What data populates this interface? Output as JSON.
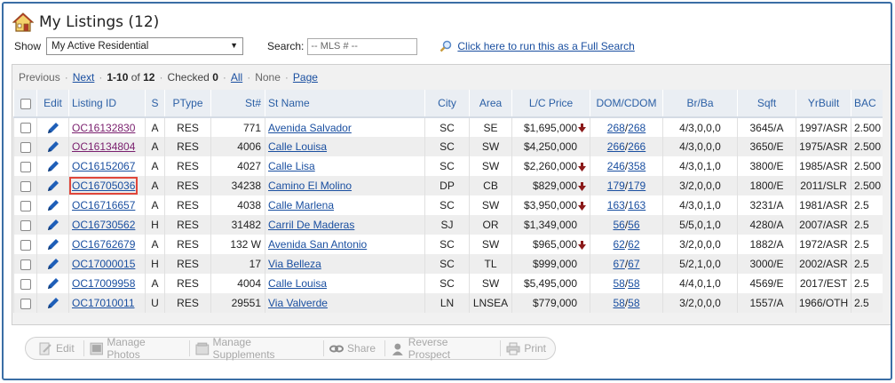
{
  "header": {
    "title": "My Listings (12)"
  },
  "controls": {
    "show_label": "Show",
    "show_value": "My Active Residential",
    "search_label": "Search:",
    "search_placeholder": "-- MLS # --",
    "full_search_link": "Click here to run this as a Full Search"
  },
  "pager": {
    "previous": "Previous",
    "next": "Next",
    "range": "1-10",
    "of_label": "of",
    "total": "12",
    "checked_label": "Checked",
    "checked_count": "0",
    "all": "All",
    "none": "None",
    "page": "Page"
  },
  "columns": [
    "Edit",
    "Listing ID",
    "S",
    "PType",
    "St#",
    "St Name",
    "City",
    "Area",
    "L/C Price",
    "DOM/CDOM",
    "Br/Ba",
    "Sqft",
    "YrBuilt",
    "BAC"
  ],
  "rows": [
    {
      "id": "OC16132830",
      "s": "A",
      "ptype": "RES",
      "stnum": "771",
      "stname": "Avenida Salvador",
      "city": "SC",
      "area": "SE",
      "price": "$1,695,000",
      "price_down": true,
      "dom": "268",
      "cdom": "268",
      "brba": "4/3,0,0,0",
      "sqft": "3645/A",
      "yrbuilt": "1997/ASR",
      "bac": "2.500",
      "visited": true,
      "highlight": false
    },
    {
      "id": "OC16134804",
      "s": "A",
      "ptype": "RES",
      "stnum": "4006",
      "stname": "Calle Louisa",
      "city": "SC",
      "area": "SW",
      "price": "$4,250,000",
      "price_down": false,
      "dom": "266",
      "cdom": "266",
      "brba": "4/3,0,0,0",
      "sqft": "3650/E",
      "yrbuilt": "1975/ASR",
      "bac": "2.500",
      "visited": true,
      "highlight": false
    },
    {
      "id": "OC16152067",
      "s": "A",
      "ptype": "RES",
      "stnum": "4027",
      "stname": "Calle Lisa",
      "city": "SC",
      "area": "SW",
      "price": "$2,260,000",
      "price_down": true,
      "dom": "246",
      "cdom": "358",
      "brba": "4/3,0,1,0",
      "sqft": "3800/E",
      "yrbuilt": "1985/ASR",
      "bac": "2.500",
      "visited": false,
      "highlight": false
    },
    {
      "id": "OC16705036",
      "s": "A",
      "ptype": "RES",
      "stnum": "34238",
      "stname": "Camino El Molino",
      "city": "DP",
      "area": "CB",
      "price": "$829,000",
      "price_down": true,
      "dom": "179",
      "cdom": "179",
      "brba": "3/2,0,0,0",
      "sqft": "1800/E",
      "yrbuilt": "2011/SLR",
      "bac": "2.500",
      "visited": false,
      "highlight": true
    },
    {
      "id": "OC16716657",
      "s": "A",
      "ptype": "RES",
      "stnum": "4038",
      "stname": "Calle Marlena",
      "city": "SC",
      "area": "SW",
      "price": "$3,950,000",
      "price_down": true,
      "dom": "163",
      "cdom": "163",
      "brba": "4/3,0,1,0",
      "sqft": "3231/A",
      "yrbuilt": "1981/ASR",
      "bac": "2.5",
      "visited": false,
      "highlight": false
    },
    {
      "id": "OC16730562",
      "s": "H",
      "ptype": "RES",
      "stnum": "31482",
      "stname": "Carril De Maderas",
      "city": "SJ",
      "area": "OR",
      "price": "$1,349,000",
      "price_down": false,
      "dom": "56",
      "cdom": "56",
      "brba": "5/5,0,1,0",
      "sqft": "4280/A",
      "yrbuilt": "2007/ASR",
      "bac": "2.5",
      "visited": false,
      "highlight": false
    },
    {
      "id": "OC16762679",
      "s": "A",
      "ptype": "RES",
      "stnum": "132 W",
      "stname": "Avenida San Antonio",
      "city": "SC",
      "area": "SW",
      "price": "$965,000",
      "price_down": true,
      "dom": "62",
      "cdom": "62",
      "brba": "3/2,0,0,0",
      "sqft": "1882/A",
      "yrbuilt": "1972/ASR",
      "bac": "2.5",
      "visited": false,
      "highlight": false
    },
    {
      "id": "OC17000015",
      "s": "H",
      "ptype": "RES",
      "stnum": "17",
      "stname": "Via Belleza",
      "city": "SC",
      "area": "TL",
      "price": "$999,000",
      "price_down": false,
      "dom": "67",
      "cdom": "67",
      "brba": "5/2,1,0,0",
      "sqft": "3000/E",
      "yrbuilt": "2002/ASR",
      "bac": "2.5",
      "visited": false,
      "highlight": false
    },
    {
      "id": "OC17009958",
      "s": "A",
      "ptype": "RES",
      "stnum": "4004",
      "stname": "Calle Louisa",
      "city": "SC",
      "area": "SW",
      "price": "$5,495,000",
      "price_down": false,
      "dom": "58",
      "cdom": "58",
      "brba": "4/4,0,1,0",
      "sqft": "4569/E",
      "yrbuilt": "2017/EST",
      "bac": "2.5",
      "visited": false,
      "highlight": false
    },
    {
      "id": "OC17010011",
      "s": "U",
      "ptype": "RES",
      "stnum": "29551",
      "stname": "Via Valverde",
      "city": "LN",
      "area": "LNSEA",
      "price": "$779,000",
      "price_down": false,
      "dom": "58",
      "cdom": "58",
      "brba": "3/2,0,0,0",
      "sqft": "1557/A",
      "yrbuilt": "1966/OTH",
      "bac": "2.5",
      "visited": false,
      "highlight": false
    }
  ],
  "toolbar": {
    "edit": "Edit",
    "manage_photos": "Manage Photos",
    "manage_supplements": "Manage Supplements",
    "share": "Share",
    "reverse_prospect": "Reverse Prospect",
    "print": "Print"
  },
  "colors": {
    "link": "#1a4fa0",
    "visited_link": "#7a1f6e",
    "header_text": "#2b5fa5",
    "price_down_arrow": "#8b1a1a",
    "highlight_box": "#e0463a",
    "frame_border": "#3a6ea5"
  }
}
